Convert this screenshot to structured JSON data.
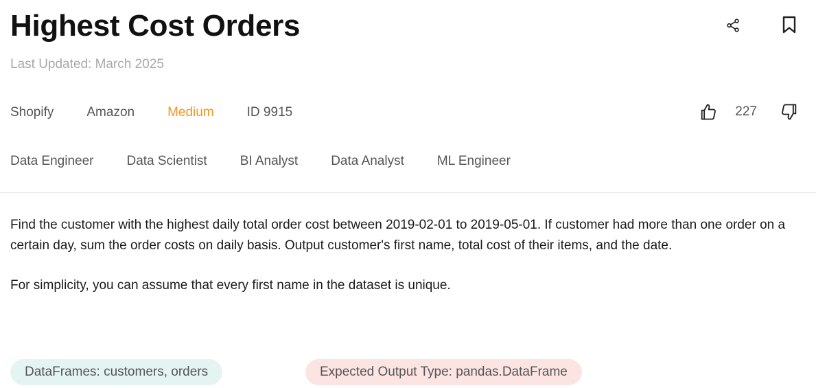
{
  "title": "Highest Cost Orders",
  "last_updated": "Last Updated: March 2025",
  "icons": {
    "share": "share-icon",
    "bookmark": "bookmark-icon",
    "upvote": "thumbs-up-icon",
    "downvote": "thumbs-down-icon"
  },
  "meta": {
    "companies": [
      "Shopify",
      "Amazon"
    ],
    "difficulty": "Medium",
    "question_id": "ID 9915"
  },
  "votes": {
    "count": "227"
  },
  "roles": [
    "Data Engineer",
    "Data Scientist",
    "BI Analyst",
    "Data Analyst",
    "ML Engineer"
  ],
  "description": {
    "paragraph_1": "Find the customer with the highest daily total order cost between 2019-02-01 to 2019-05-01. If customer had more than one order on a certain day, sum the order costs on daily basis. Output customer's first name, total cost of their items, and the date.",
    "paragraph_2": "For simplicity, you can assume that every first name in the dataset is unique."
  },
  "chips": {
    "dataframes": "DataFrames: customers, orders",
    "output_type": "Expected Output Type: pandas.DataFrame"
  },
  "colors": {
    "difficulty_medium": "#f7941d",
    "chip_dataframes_bg": "#e4f4f2",
    "chip_output_bg": "#fbe4e2",
    "muted_text": "#a8a8a8"
  }
}
